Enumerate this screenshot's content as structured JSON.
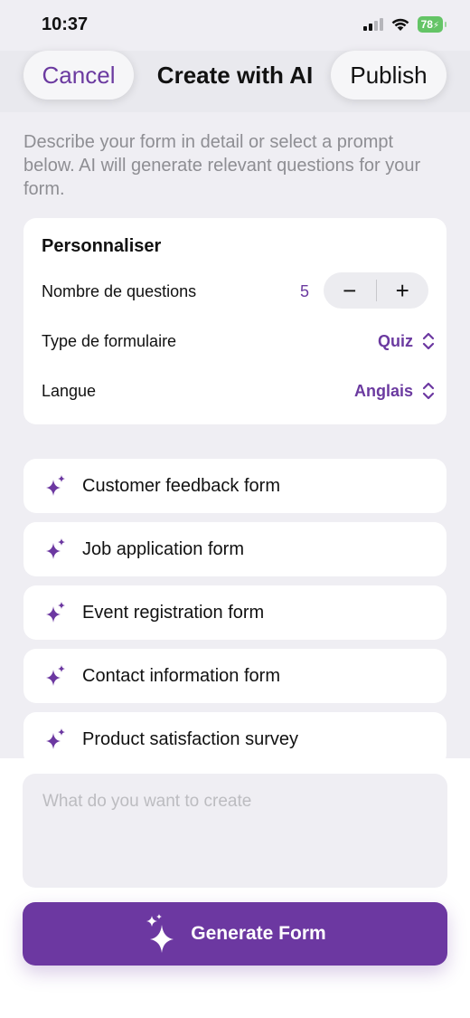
{
  "status_bar": {
    "time": "10:37",
    "battery": "78"
  },
  "nav": {
    "cancel_label": "Cancel",
    "title": "Create with AI",
    "publish_label": "Publish"
  },
  "intro_text": "Describe your form in detail or select a prompt below. AI will generate relevant questions for your form.",
  "settings": {
    "title": "Personnaliser",
    "rows": [
      {
        "label": "Nombre de questions",
        "value": "5"
      },
      {
        "label": "Type de formulaire",
        "value": "Quiz"
      },
      {
        "label": "Langue",
        "value": "Anglais"
      }
    ],
    "stepper": {
      "minus": "−",
      "plus": "+"
    }
  },
  "prompts": [
    {
      "label": "Customer feedback form"
    },
    {
      "label": "Job application form"
    },
    {
      "label": "Event registration form"
    },
    {
      "label": "Contact information form"
    },
    {
      "label": "Product satisfaction survey"
    }
  ],
  "composer": {
    "placeholder": "What do you want to create",
    "generate_label": "Generate Form"
  },
  "colors": {
    "accent": "#6c38a1",
    "background": "#efeef3",
    "muted_text": "#8e8e93"
  },
  "icons": {
    "prompt": "sparkles-icon",
    "generate": "sparkles-icon",
    "selector": "chevron-up-down-icon"
  }
}
